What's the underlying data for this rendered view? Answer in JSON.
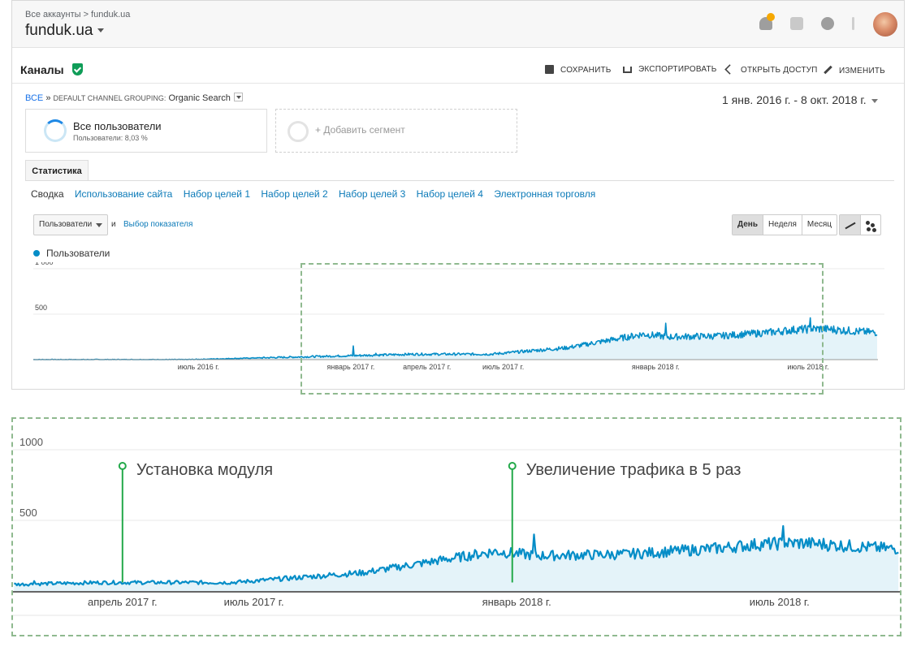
{
  "topbar": {
    "breadcrumb": "Все аккаунты > funduk.ua",
    "account": "funduk.ua"
  },
  "report": {
    "title": "Каналы",
    "actions": {
      "save": "СОХРАНИТЬ",
      "export": "ЭКСПОРТИРОВАТЬ",
      "share": "ОТКРЫТЬ ДОСТУП",
      "edit": "ИЗМЕНИТЬ"
    },
    "path_all": "ВСЕ",
    "path_sep": "»",
    "path_group": "DEFAULT CHANNEL GROUPING:",
    "path_value": "Organic Search",
    "date_range": "1 янв. 2016 г. - 8 окт. 2018 г."
  },
  "segments": {
    "users_title": "Все пользователи",
    "users_sub": "Пользователи: 8,03 %",
    "add": "+ Добавить сегмент"
  },
  "tabs": {
    "stats": "Статистика",
    "subtabs": [
      "Сводка",
      "Использование сайта",
      "Набор целей 1",
      "Набор целей 2",
      "Набор целей 3",
      "Набор целей 4",
      "Электронная торговля"
    ]
  },
  "controls": {
    "metric": "Пользователи",
    "and": "и",
    "pick_metric": "Выбор показателя",
    "periods": [
      "День",
      "Неделя",
      "Месяц"
    ]
  },
  "legend": "Пользователи",
  "colors": {
    "line": "#058dc7",
    "fill": "#e4f3f9",
    "annotation": "#23a94a",
    "highlight": "#8fb98f"
  },
  "chart_data": [
    {
      "type": "area",
      "series": [
        {
          "name": "Пользователи"
        }
      ],
      "y_ticks": [
        "1 000",
        "500"
      ],
      "ylim": [
        0,
        1000
      ],
      "x_ticks": [
        "июль 2016 г.",
        "январь 2017 г.",
        "апрель 2017 г.",
        "июль 2017 г.",
        "январь 2018 г.",
        "июль 2018 г."
      ],
      "x": [
        "2016-01",
        "2016-07",
        "2017-01",
        "2017-04",
        "2017-07",
        "2017-10",
        "2018-01",
        "2018-02",
        "2018-04",
        "2018-06",
        "2018-07",
        "2018-08",
        "2018-10"
      ],
      "values": [
        0,
        0,
        40,
        60,
        60,
        130,
        280,
        250,
        260,
        300,
        330,
        340,
        300
      ]
    },
    {
      "type": "area",
      "y_ticks": [
        "1000",
        "500"
      ],
      "ylim": [
        0,
        1000
      ],
      "x_ticks": [
        "апрель 2017 г.",
        "июль 2017 г.",
        "январь 2018 г.",
        "июль 2018 г."
      ],
      "annotations": [
        "Установка модуля",
        "Увеличение трафика в 5 раз"
      ]
    }
  ]
}
